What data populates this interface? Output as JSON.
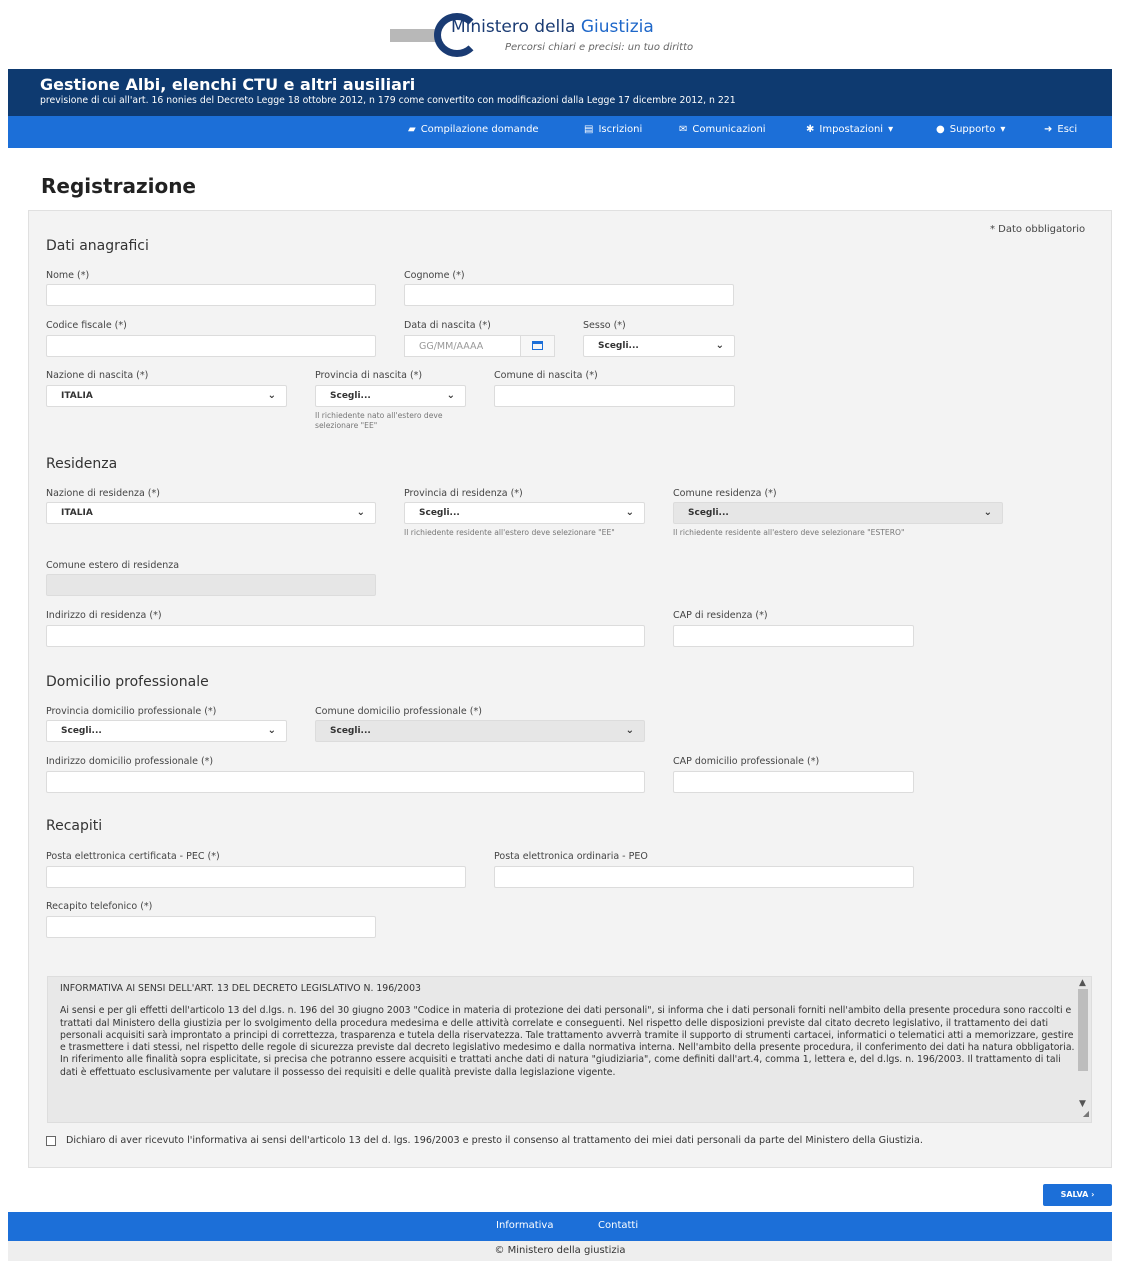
{
  "brand": {
    "name_part1": "Ministero della ",
    "name_part2": "Giustizia",
    "tagline": "Percorsi chiari e precisi: un tuo diritto"
  },
  "header": {
    "title": "Gestione Albi, elenchi CTU e altri ausiliari",
    "subtitle": "previsione di cui all'art. 16 nonies del Decreto Legge 18 ottobre 2012, n 179 come convertito con modificazioni dalla Legge 17 dicembre 2012, n 221"
  },
  "nav": {
    "compilazione": "Compilazione domande",
    "iscrizioni": "Iscrizioni",
    "comunicazioni": "Comunicazioni",
    "impostazioni": "Impostazioni",
    "supporto": "Supporto",
    "esci": "Esci"
  },
  "page_title": "Registrazione",
  "required_note": "* Dato obbligatorio",
  "anagrafici": {
    "heading": "Dati anagrafici",
    "nome": "Nome (*)",
    "cognome": "Cognome (*)",
    "codice_fiscale": "Codice fiscale (*)",
    "data_nascita": "Data di nascita (*)",
    "data_placeholder": "GG/MM/AAAA",
    "sesso": "Sesso (*)",
    "sesso_value": "Scegli...",
    "nazione_nascita": "Nazione di nascita (*)",
    "nazione_nascita_value": "ITALIA",
    "provincia_nascita": "Provincia di nascita (*)",
    "provincia_nascita_value": "Scegli...",
    "provincia_nascita_help": "Il richiedente nato all'estero deve selezionare \"EE\"",
    "comune_nascita": "Comune di nascita (*)"
  },
  "residenza": {
    "heading": "Residenza",
    "nazione": "Nazione di residenza (*)",
    "nazione_value": "ITALIA",
    "provincia": "Provincia di residenza (*)",
    "provincia_value": "Scegli...",
    "provincia_help": "Il richiedente residente all'estero deve selezionare \"EE\"",
    "comune": "Comune residenza (*)",
    "comune_value": "Scegli...",
    "comune_help": "Il richiedente residente all'estero deve selezionare \"ESTERO\"",
    "comune_estero": "Comune estero di residenza",
    "indirizzo": "Indirizzo di residenza (*)",
    "cap": "CAP di residenza (*)"
  },
  "domicilio": {
    "heading": "Domicilio professionale",
    "provincia": "Provincia domicilio professionale (*)",
    "provincia_value": "Scegli...",
    "comune": "Comune domicilio professionale (*)",
    "comune_value": "Scegli...",
    "indirizzo": "Indirizzo domicilio professionale (*)",
    "cap": "CAP domicilio professionale (*)"
  },
  "recapiti": {
    "heading": "Recapiti",
    "pec": "Posta elettronica certificata - PEC (*)",
    "peo": "Posta elettronica ordinaria - PEO",
    "telefono": "Recapito telefonico (*)"
  },
  "informativa": {
    "title": "INFORMATIVA AI SENSI DELL'ART. 13 DEL DECRETO LEGISLATIVO N. 196/2003",
    "body": "Ai sensi e per gli effetti dell'articolo 13 del d.lgs. n. 196 del 30 giugno 2003 \"Codice in materia di protezione dei dati personali\", si informa che i dati personali forniti nell'ambito della presente procedura sono raccolti e trattati dal Ministero della giustizia per lo svolgimento della procedura medesima e delle attività correlate e conseguenti. Nel rispetto delle disposizioni previste dal citato decreto legislativo, il trattamento dei dati personali acquisiti sarà improntato a principi di correttezza, trasparenza e tutela della riservatezza. Tale trattamento avverrà tramite il supporto di strumenti cartacei, informatici o telematici atti a memorizzare, gestire e trasmettere i dati stessi, nel rispetto delle regole di sicurezza previste dal decreto legislativo medesimo e dalla normativa interna. Nell'ambito della presente procedura, il conferimento dei dati ha natura obbligatoria. In riferimento alle finalità sopra esplicitate, si precisa che potranno essere acquisiti e trattati anche dati di natura \"giudiziaria\", come definiti dall'art.4, comma 1, lettera e, del d.lgs. n. 196/2003. Il trattamento di tali dati è effettuato esclusivamente per valutare il possesso dei requisiti e delle qualità previste dalla legislazione vigente."
  },
  "consent_label": "Dichiaro di aver ricevuto l'informativa ai sensi dell'articolo 13 del d. lgs. 196/2003 e presto il consenso al trattamento dei miei dati personali da parte del Ministero della Giustizia.",
  "save_label": "SALVA ›",
  "footer": {
    "informativa": "Informativa",
    "contatti": "Contatti",
    "copyright": "© Ministero della giustizia"
  }
}
